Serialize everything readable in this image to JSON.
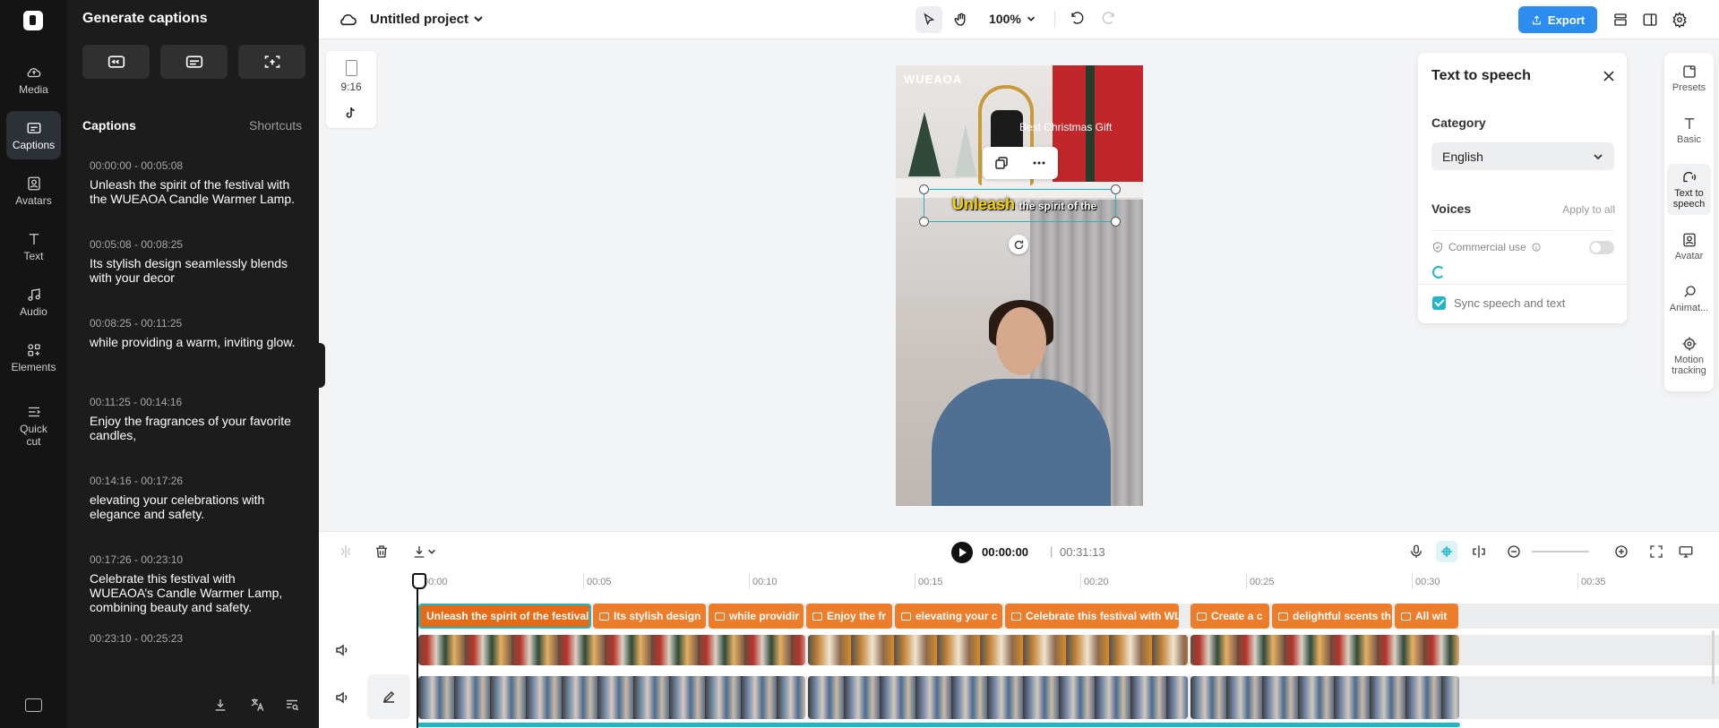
{
  "app": {
    "project_title": "Untitled project",
    "zoom": "100%",
    "export_label": "Export"
  },
  "rail": {
    "items": [
      {
        "label": "Media",
        "icon": "cloud-upload-icon"
      },
      {
        "label": "Captions",
        "icon": "captions-icon",
        "active": true
      },
      {
        "label": "Avatars",
        "icon": "avatar-icon"
      },
      {
        "label": "Text",
        "icon": "text-icon"
      },
      {
        "label": "Audio",
        "icon": "music-note-icon"
      },
      {
        "label": "Elements",
        "icon": "elements-grid-icon"
      },
      {
        "label": "Quick cut",
        "icon": "quick-cut-icon"
      }
    ]
  },
  "captions_panel": {
    "title": "Generate captions",
    "section_title": "Captions",
    "shortcuts_label": "Shortcuts",
    "items": [
      {
        "time": "00:00:00 - 00:05:08",
        "text": "Unleash the spirit of the festival with the WUEAOA Candle Warmer Lamp."
      },
      {
        "time": "00:05:08 - 00:08:25",
        "text": "Its stylish design seamlessly blends with your decor"
      },
      {
        "time": "00:08:25 - 00:11:25",
        "text": "while providing a warm, inviting glow."
      },
      {
        "time": "00:11:25 - 00:14:16",
        "text": "Enjoy the fragrances of your favorite candles,"
      },
      {
        "time": "00:14:16 - 00:17:26",
        "text": "elevating your celebrations with elegance and safety."
      },
      {
        "time": "00:17:26 - 00:23:10",
        "text": "Celebrate this festival with WUEAOA’s Candle Warmer Lamp, combining beauty and safety."
      },
      {
        "time": "00:23:10 - 00:25:23",
        "text": ""
      }
    ]
  },
  "aspect": {
    "ratio": "9:16"
  },
  "preview": {
    "brand": "WUEAOA",
    "gift_text": "Best Christmas Gift",
    "caption_highlight": "Unleash",
    "caption_rest": "the spirit of the"
  },
  "tts": {
    "title": "Text to speech",
    "category_label": "Category",
    "category_value": "English",
    "voices_label": "Voices",
    "apply_all": "Apply to all",
    "commercial_use": "Commercial use",
    "sync_label": "Sync speech and text"
  },
  "props_rail": {
    "items": [
      {
        "label": "Presets"
      },
      {
        "label": "Basic"
      },
      {
        "label": "Text to speech"
      },
      {
        "label": "Avatar"
      },
      {
        "label": "Animat..."
      },
      {
        "label": "Motion tracking"
      }
    ]
  },
  "timeline": {
    "current_time": "00:00:00",
    "separator": "|",
    "total_time": "00:31:13",
    "ruler": [
      "00:00",
      "00:05",
      "00:10",
      "00:15",
      "00:20",
      "00:25",
      "00:30",
      "00:35"
    ],
    "caption_clips": [
      "Unleash the spirit of the festival",
      "Its stylish design",
      "while providir",
      "Enjoy the fr",
      "elevating your c",
      "Celebrate this festival with WL",
      "Create a c",
      "delightful scents th",
      "All wit"
    ]
  },
  "colors": {
    "accent": "#21b5c7",
    "export": "#2d8cf0",
    "caption_clip": "#ee7d2b",
    "dark_panel": "#1c1c1c"
  }
}
